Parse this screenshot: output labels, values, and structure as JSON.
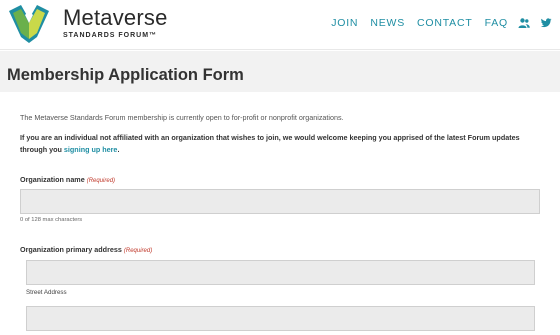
{
  "brand": {
    "name": "Metaverse",
    "subtitle": "STANDARDS FORUM™",
    "logo_colors": [
      "#1f8ea3",
      "#6ab04c",
      "#c9d94a"
    ]
  },
  "nav": {
    "items": [
      {
        "label": "JOIN"
      },
      {
        "label": "NEWS"
      },
      {
        "label": "CONTACT"
      },
      {
        "label": "FAQ"
      }
    ],
    "icons": [
      "users-icon",
      "twitter-icon"
    ],
    "color": "#1f8ea3"
  },
  "page": {
    "title": "Membership Application Form"
  },
  "form": {
    "intro": "The Metaverse Standards Forum membership is currently open to for-profit or nonprofit organizations.",
    "notice_text": "If you are an individual not affiliated with an organization that wishes to join, we would welcome keeping you apprised of the latest Forum updates through you ",
    "notice_link": "signing up here",
    "notice_end": ".",
    "org_name": {
      "label": "Organization name",
      "required": "(Required)",
      "value": "",
      "hint": "0 of 128 max characters"
    },
    "org_address": {
      "label": "Organization primary address",
      "required": "(Required)",
      "street_value": "",
      "street_label": "Street Address",
      "line2_value": ""
    }
  }
}
